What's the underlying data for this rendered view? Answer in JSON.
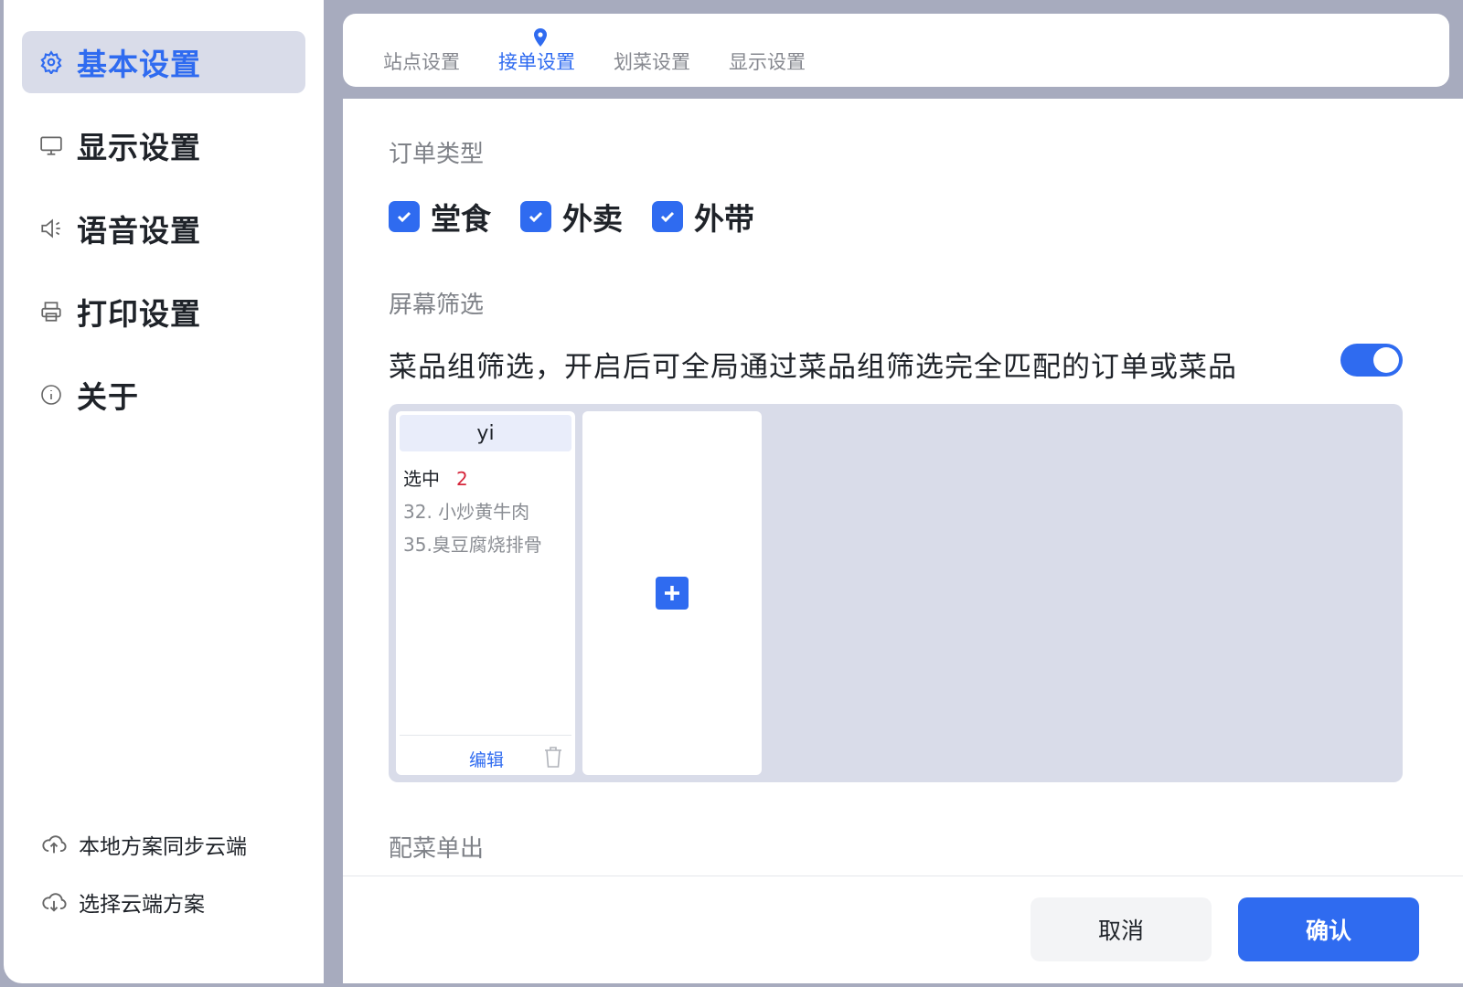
{
  "sidebar": {
    "items": [
      {
        "label": "基本设置",
        "icon": "gear-icon",
        "active": true
      },
      {
        "label": "显示设置",
        "icon": "monitor-icon"
      },
      {
        "label": "语音设置",
        "icon": "speaker-icon"
      },
      {
        "label": "打印设置",
        "icon": "printer-icon"
      },
      {
        "label": "关于",
        "icon": "info-icon"
      }
    ],
    "sync_local": "本地方案同步云端",
    "select_cloud": "选择云端方案"
  },
  "tabs": [
    {
      "label": "站点设置"
    },
    {
      "label": "接单设置",
      "active": true
    },
    {
      "label": "划菜设置"
    },
    {
      "label": "显示设置"
    }
  ],
  "order_type": {
    "title": "订单类型",
    "options": [
      {
        "label": "堂食",
        "checked": true
      },
      {
        "label": "外卖",
        "checked": true
      },
      {
        "label": "外带",
        "checked": true
      }
    ]
  },
  "screen_filter": {
    "title": "屏幕筛选",
    "description": "菜品组筛选，开启后可全局通过菜品组筛选完全匹配的订单或菜品",
    "enabled": true,
    "groups": [
      {
        "name": "yi",
        "selected_label": "选中",
        "selected_count": "2",
        "items": [
          "32. 小炒黄牛肉",
          "35.臭豆腐烧排骨"
        ],
        "edit_label": "编辑"
      }
    ]
  },
  "side_dish": {
    "title": "配菜单出"
  },
  "actions": {
    "cancel": "取消",
    "confirm": "确认"
  },
  "colors": {
    "accent": "#2f6bf0",
    "count_red": "#d6263b",
    "active_bg": "#d9dce9"
  }
}
